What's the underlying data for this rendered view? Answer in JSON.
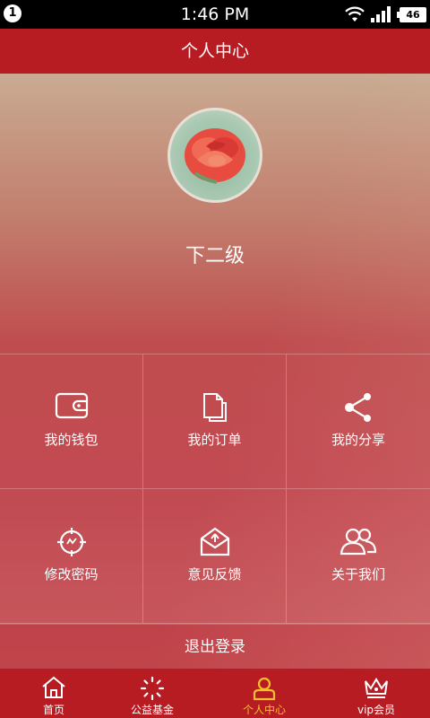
{
  "status_bar": {
    "notification_count": "1",
    "time": "1:46 PM",
    "battery": "46"
  },
  "header": {
    "title": "个人中心"
  },
  "profile": {
    "name": "下二级"
  },
  "menu": {
    "items": [
      {
        "label": "我的钱包",
        "icon": "wallet-icon"
      },
      {
        "label": "我的订单",
        "icon": "orders-icon"
      },
      {
        "label": "我的分享",
        "icon": "share-icon"
      },
      {
        "label": "修改密码",
        "icon": "password-icon"
      },
      {
        "label": "意见反馈",
        "icon": "feedback-icon"
      },
      {
        "label": "关于我们",
        "icon": "about-us-icon"
      }
    ]
  },
  "logout_label": "退出登录",
  "bottom_nav": {
    "items": [
      {
        "label": "首页",
        "icon": "home-icon",
        "active": false
      },
      {
        "label": "公益基金",
        "icon": "charity-icon",
        "active": false
      },
      {
        "label": "个人中心",
        "icon": "profile-icon",
        "active": true
      },
      {
        "label": "vip会员",
        "icon": "crown-icon",
        "active": false
      }
    ]
  },
  "colors": {
    "brand_red": "#b71c23",
    "active_yellow": "#f3c02c"
  }
}
